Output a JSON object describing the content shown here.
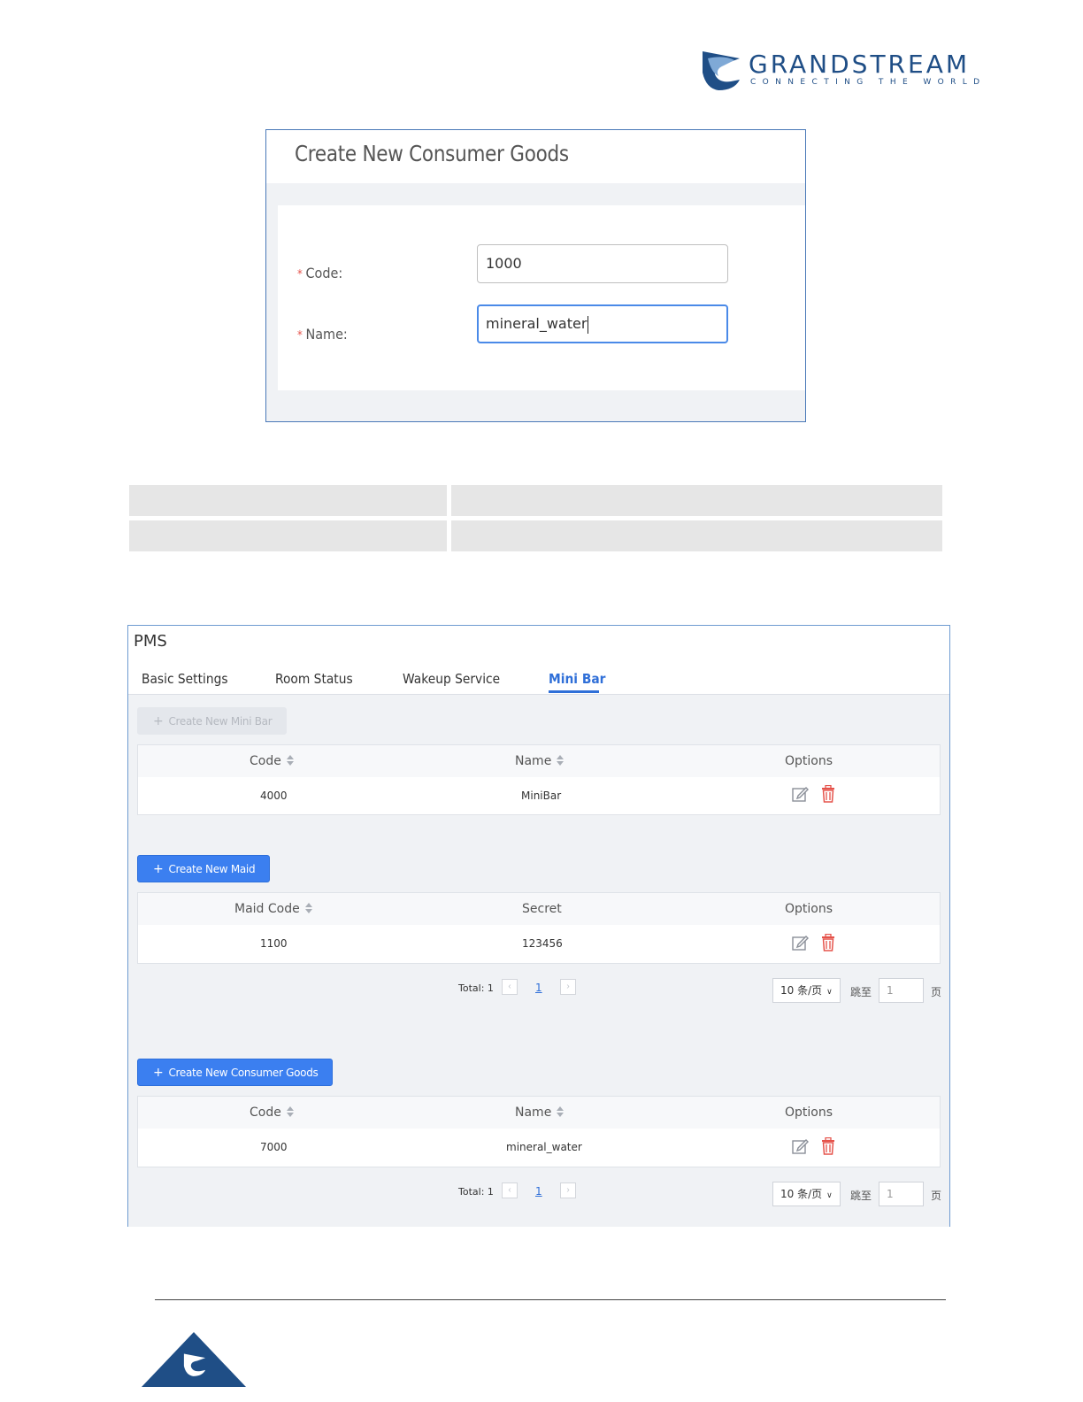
{
  "brand": {
    "name": "GRANDSTREAM",
    "tagline": "CONNECTING THE WORLD",
    "color": "#1f4e86"
  },
  "dialog": {
    "title": "Create New Consumer Goods",
    "fields": [
      {
        "label": "Code:",
        "required": true,
        "value": "1000"
      },
      {
        "label": "Name:",
        "required": true,
        "value": "mineral_water"
      }
    ]
  },
  "pms": {
    "title": "PMS",
    "tabs": [
      {
        "label": "Basic Settings",
        "active": false
      },
      {
        "label": "Room Status",
        "active": false
      },
      {
        "label": "Wakeup Service",
        "active": false
      },
      {
        "label": "Mini Bar",
        "active": true
      }
    ],
    "minibar": {
      "create_button": "Create New Mini Bar",
      "create_enabled": false,
      "columns": [
        "Code",
        "Name",
        "Options"
      ],
      "rows": [
        {
          "code": "4000",
          "name": "MiniBar"
        }
      ]
    },
    "maid": {
      "create_button": "Create New Maid",
      "columns": [
        "Maid Code",
        "Secret",
        "Options"
      ],
      "rows": [
        {
          "code": "1100",
          "secret": "123456"
        }
      ],
      "pager": {
        "total": "Total: 1",
        "page": "1",
        "page_size": "10 条/页",
        "jump_label": "跳至",
        "jump_value": "1",
        "page_suffix": "页"
      }
    },
    "goods": {
      "create_button": "Create New Consumer Goods",
      "columns": [
        "Code",
        "Name",
        "Options"
      ],
      "rows": [
        {
          "code": "7000",
          "name": "mineral_water"
        }
      ],
      "pager": {
        "total": "Total: 1",
        "page": "1",
        "page_size": "10 条/页",
        "jump_label": "跳至",
        "jump_value": "1",
        "page_suffix": "页"
      }
    },
    "colors": {
      "accent": "#3b7ff0",
      "delete": "#e5534b"
    }
  }
}
